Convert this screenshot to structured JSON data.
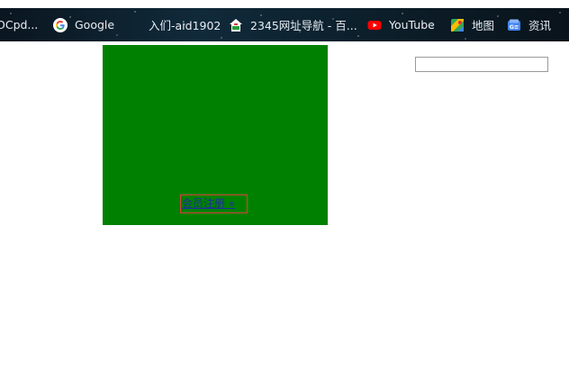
{
  "bookmarks": [
    {
      "label": "OCpd...",
      "icon": "none"
    },
    {
      "label": "Google",
      "icon": "google-icon"
    },
    {
      "label": "入们-aid1902",
      "icon": "none"
    },
    {
      "label": "2345网址导航 - 百...",
      "icon": "2345-icon"
    },
    {
      "label": "YouTube",
      "icon": "youtube-icon"
    },
    {
      "label": "地图",
      "icon": "maps-icon"
    },
    {
      "label": "资讯",
      "icon": "news-icon"
    }
  ],
  "main": {
    "box_color": "#008000",
    "link_text": "会员注册 »",
    "search_value": "",
    "search_placeholder": ""
  },
  "colors": {
    "bookmark_bar": "#0b1720",
    "link": "#1f2f9e",
    "link_border": "#d64040"
  }
}
